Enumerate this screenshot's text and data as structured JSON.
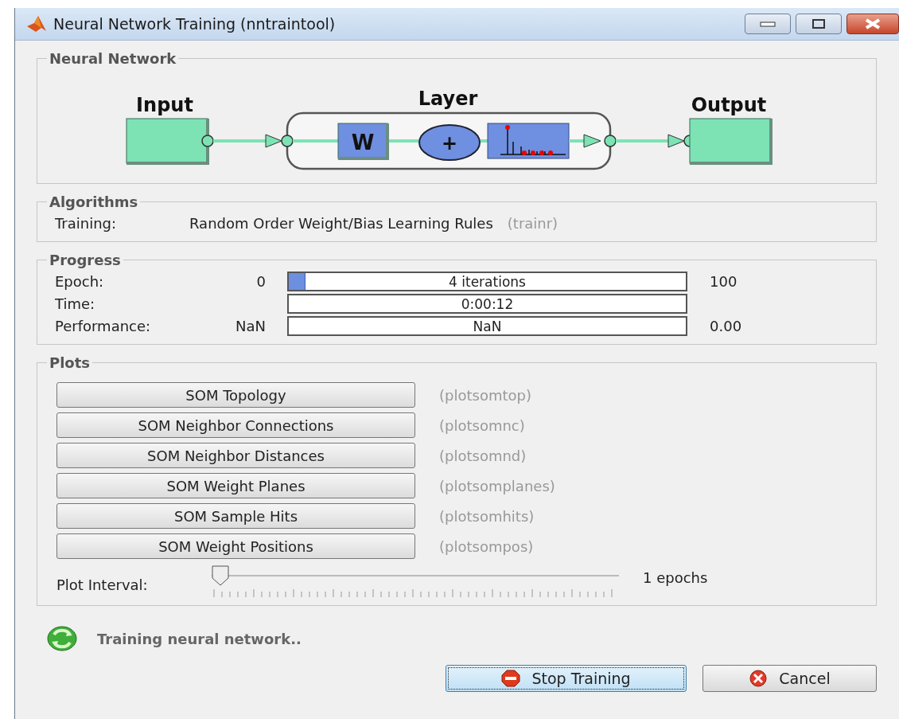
{
  "window": {
    "title": "Neural Network Training (nntraintool)"
  },
  "network": {
    "title": "Neural Network",
    "input_label": "Input",
    "layer_label": "Layer",
    "output_label": "Output",
    "weight_symbol": "W",
    "sum_symbol": "+"
  },
  "algorithms": {
    "title": "Algorithms",
    "rows": [
      {
        "label": "Training:",
        "value": "Random Order Weight/Bias Learning Rules",
        "function": "(trainr)"
      }
    ]
  },
  "progress": {
    "title": "Progress",
    "rows": [
      {
        "label": "Epoch:",
        "start": "0",
        "text": "4 iterations",
        "level": 0.04,
        "end": "100"
      },
      {
        "label": "Time:",
        "text": "0:00:12"
      },
      {
        "label": "Performance:",
        "start": "NaN",
        "text": "NaN",
        "end": "0.00"
      }
    ]
  },
  "plots": {
    "title": "Plots",
    "buttons": [
      {
        "label": "SOM Topology",
        "function": "(plotsomtop)"
      },
      {
        "label": "SOM Neighbor Connections",
        "function": "(plotsomnc)"
      },
      {
        "label": "SOM Neighbor Distances",
        "function": "(plotsomnd)"
      },
      {
        "label": "SOM Weight Planes",
        "function": "(plotsomplanes)"
      },
      {
        "label": "SOM Sample Hits",
        "function": "(plotsomhits)"
      },
      {
        "label": "SOM Weight Positions",
        "function": "(plotsompos)"
      }
    ],
    "interval": {
      "label": "Plot Interval:",
      "level": 0,
      "reading": "1 epochs"
    }
  },
  "status": {
    "text": "Training neural network.."
  },
  "buttons": [
    {
      "kind": "stop",
      "label": "Stop Training",
      "focused": true
    },
    {
      "kind": "cancel",
      "label": "Cancel",
      "focused": false
    }
  ]
}
